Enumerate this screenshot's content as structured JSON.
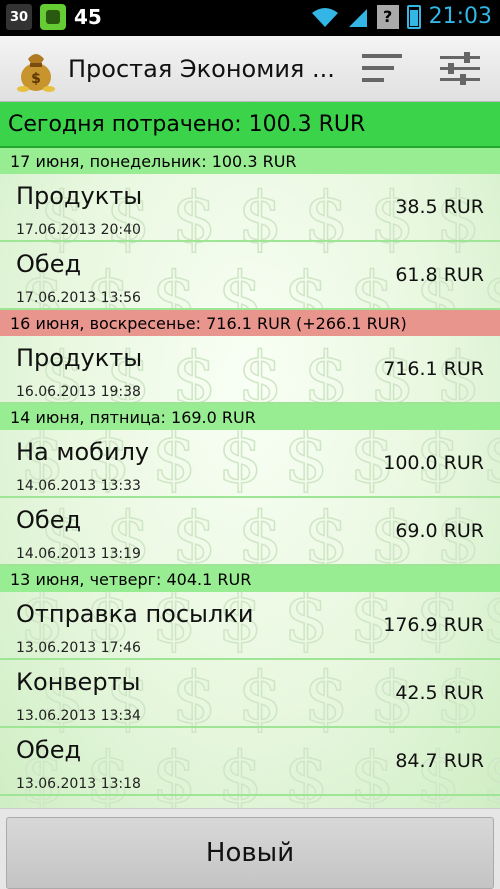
{
  "status_bar": {
    "temperature": "30",
    "notification_count": "45",
    "time": "21:03",
    "accent_color": "#33b5e5"
  },
  "action_bar": {
    "title": "Простая Экономия ...",
    "app_icon": "money-bag-icon",
    "sort_icon": "sort-icon",
    "filter_icon": "settings-sliders-icon"
  },
  "summary": {
    "today_label": "Сегодня потрачено: 100.3 RUR"
  },
  "colors": {
    "today_bg": "#3ad34a",
    "day_under_budget": "#98ec92",
    "day_over_budget": "#e8958e"
  },
  "days": [
    {
      "header": "17 июня, понедельник: 100.3 RUR",
      "status": "green",
      "entries": [
        {
          "name": "Продукты",
          "date": "17.06.2013 20:40",
          "amount": "38.5 RUR"
        },
        {
          "name": "Обед",
          "date": "17.06.2013 13:56",
          "amount": "61.8 RUR"
        }
      ]
    },
    {
      "header": "16 июня, воскресенье: 716.1 RUR (+266.1 RUR)",
      "status": "red",
      "entries": [
        {
          "name": "Продукты",
          "date": "16.06.2013 19:38",
          "amount": "716.1 RUR"
        }
      ]
    },
    {
      "header": "14 июня, пятница: 169.0 RUR",
      "status": "green",
      "entries": [
        {
          "name": "На мобилу",
          "date": "14.06.2013 13:33",
          "amount": "100.0 RUR"
        },
        {
          "name": "Обед",
          "date": "14.06.2013 13:19",
          "amount": "69.0 RUR"
        }
      ]
    },
    {
      "header": "13 июня, четверг: 404.1 RUR",
      "status": "green",
      "entries": [
        {
          "name": "Отправка посылки",
          "date": "13.06.2013 17:46",
          "amount": "176.9 RUR"
        },
        {
          "name": "Конверты",
          "date": "13.06.2013 13:34",
          "amount": "42.5 RUR"
        },
        {
          "name": "Обед",
          "date": "13.06.2013 13:18",
          "amount": "84.7 RUR"
        }
      ]
    }
  ],
  "bottom": {
    "new_button_label": "Новый"
  }
}
